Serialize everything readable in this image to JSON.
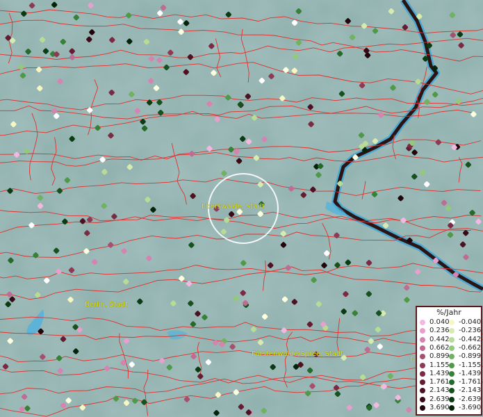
{
  "places": [
    {
      "name": "Eberswalde, Stadt"
    },
    {
      "name": "Berlin, Stadt"
    },
    {
      "name": "Fürstenwalde/Spree, Stadt"
    },
    {
      "name": "F"
    }
  ],
  "legend": {
    "title": "%/Jahr",
    "positive": [
      {
        "value": "0.040",
        "color": "#f2b8e0"
      },
      {
        "value": "0.236",
        "color": "#e79fcc"
      },
      {
        "value": "0.442",
        "color": "#d584b0"
      },
      {
        "value": "0.662",
        "color": "#bf6c94"
      },
      {
        "value": "0.899",
        "color": "#a6506f"
      },
      {
        "value": "1.155",
        "color": "#8f3a55"
      },
      {
        "value": "1.439",
        "color": "#7b2a43"
      },
      {
        "value": "1.761",
        "color": "#651b31"
      },
      {
        "value": "2.143",
        "color": "#4e1122"
      },
      {
        "value": "2.639",
        "color": "#390a16"
      },
      {
        "value": "3.690",
        "color": "#22050c"
      }
    ],
    "negative": [
      {
        "value": "-0.040",
        "color": "#f6f7c4"
      },
      {
        "value": "-0.236",
        "color": "#d6ebb0"
      },
      {
        "value": "-0.442",
        "color": "#b8dc96"
      },
      {
        "value": "-0.662",
        "color": "#93c97a"
      },
      {
        "value": "-0.899",
        "color": "#6fb25f"
      },
      {
        "value": "-1.155",
        "color": "#4f9a49"
      },
      {
        "value": "-1.439",
        "color": "#378238"
      },
      {
        "value": "-1.761",
        "color": "#246a2a"
      },
      {
        "value": "-2.143",
        "color": "#16521e"
      },
      {
        "value": "-2.639",
        "color": "#0b3b13"
      },
      {
        "value": "-3.690",
        "color": "#03230a"
      }
    ]
  },
  "colors": {
    "border": "#e0302c",
    "river": "#3fa7d6",
    "national_border": "#2a1414",
    "place_label": "#e6e600",
    "highlight_ring": "#ffffff"
  }
}
